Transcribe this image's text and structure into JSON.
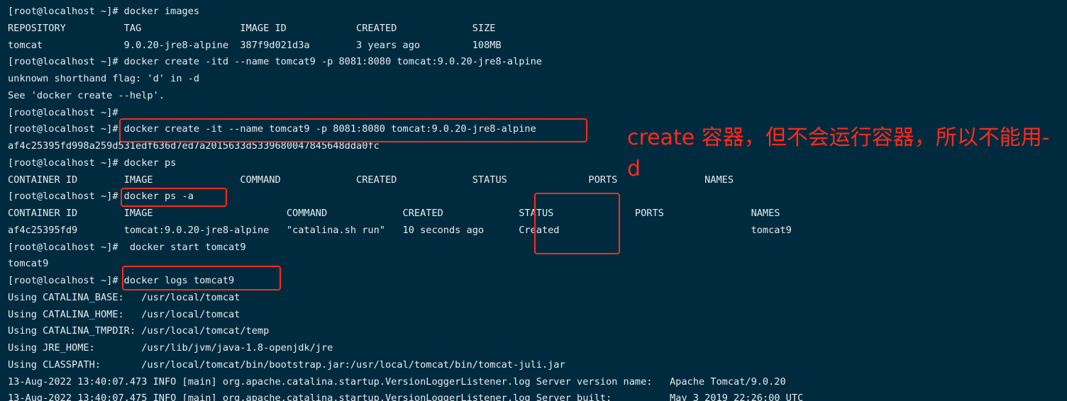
{
  "terminal": {
    "lines": [
      "[root@localhost ~]# docker images",
      "REPOSITORY          TAG                 IMAGE ID            CREATED             SIZE",
      "tomcat              9.0.20-jre8-alpine  387f9d021d3a        3 years ago         108MB",
      "[root@localhost ~]# docker create -itd --name tomcat9 -p 8081:8080 tomcat:9.0.20-jre8-alpine",
      "unknown shorthand flag: 'd' in -d",
      "See 'docker create --help'.",
      "[root@localhost ~]#",
      "[root@localhost ~]# docker create -it --name tomcat9 -p 8081:8080 tomcat:9.0.20-jre8-alpine",
      "af4c25395fd998a259d531edf636d7ed7a2015633d5339680047845648dda0fc",
      "[root@localhost ~]# docker ps",
      "CONTAINER ID        IMAGE               COMMAND             CREATED             STATUS              PORTS               NAMES",
      "[root@localhost ~]# docker ps -a",
      "CONTAINER ID        IMAGE                       COMMAND             CREATED             STATUS              PORTS               NAMES",
      "af4c25395fd9        tomcat:9.0.20-jre8-alpine   \"catalina.sh run\"   10 seconds ago      Created                                 tomcat9",
      "[root@localhost ~]#  docker start tomcat9",
      "tomcat9",
      "[root@localhost ~]# docker logs tomcat9",
      "Using CATALINA_BASE:   /usr/local/tomcat",
      "Using CATALINA_HOME:   /usr/local/tomcat",
      "Using CATALINA_TMPDIR: /usr/local/tomcat/temp",
      "Using JRE_HOME:        /usr/lib/jvm/java-1.8-openjdk/jre",
      "Using CLASSPATH:       /usr/local/tomcat/bin/bootstrap.jar:/usr/local/tomcat/bin/tomcat-juli.jar",
      "13-Aug-2022 13:40:07.473 INFO [main] org.apache.catalina.startup.VersionLoggerListener.log Server version name:   Apache Tomcat/9.0.20",
      "13-Aug-2022 13:40:07.475 INFO [main] org.apache.catalina.startup.VersionLoggerListener.log Server built:          May 3 2019 22:26:00 UTC"
    ]
  },
  "annotation": {
    "text": "create 容器，但不会运行容器，所以不能用-d"
  },
  "colors": {
    "background": "#002b3f",
    "text": "#e8ecef",
    "highlight": "#ff2a1a"
  }
}
